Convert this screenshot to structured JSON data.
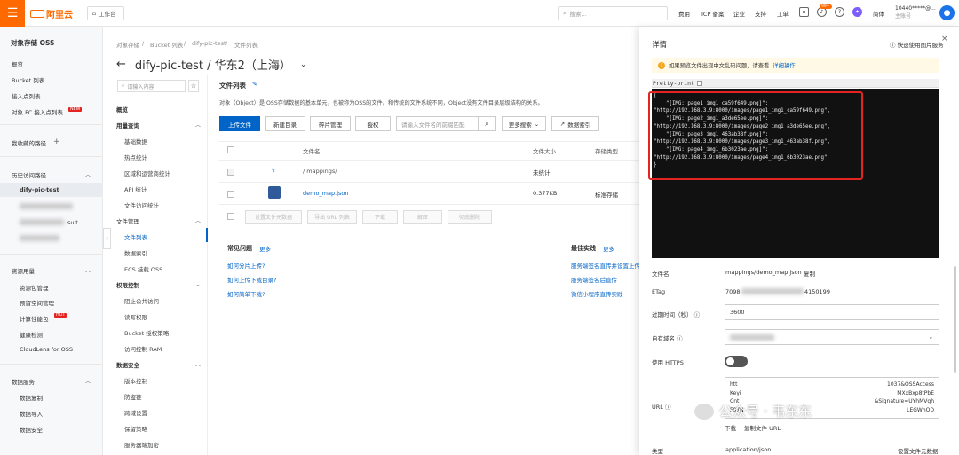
{
  "topbar": {
    "logo": "阿里云",
    "workspace": "工作台",
    "search_placeholder": "搜索...",
    "nav": [
      "费用",
      "ICP 备案",
      "企业",
      "支持",
      "工单"
    ],
    "badge": "99+",
    "lang": "简体",
    "user_id": "10440*****@...",
    "user_role": "主账号"
  },
  "sidebar": {
    "title": "对象存储 OSS",
    "items": [
      "概览",
      "Bucket 列表",
      "接入点列表",
      "对象 FC 接入点列表"
    ],
    "new_tag": "NEW",
    "favorites": "我收藏的路径",
    "history": "历史访问路径",
    "history_active": "dify-pic-test",
    "history_blur_suffix": "sult",
    "resource": "资源用量",
    "resource_items": [
      "资源包管理",
      "预留空间管理",
      "计算性能包",
      "健康检测",
      "CloudLens for OSS"
    ],
    "hot_tag": "HOT",
    "data_service": "数据服务",
    "data_items": [
      "数据复制",
      "数据导入",
      "数据安全"
    ]
  },
  "breadcrumb": [
    "对象存储",
    "Bucket 列表",
    "dify-pic-test",
    "文件列表"
  ],
  "page_title": "dify-pic-test / 华东2（上海）",
  "inner_nav": {
    "search_placeholder": "请输入内容",
    "overview": "概览",
    "groups": [
      {
        "title": "用量查询",
        "items": [
          "基础数据",
          "热点统计",
          "区域和运营商统计",
          "API 统计",
          "文件访问统计"
        ]
      },
      {
        "title": "文件管理",
        "items": [
          "文件列表",
          "数据索引",
          "ECS 挂载 OSS"
        ]
      },
      {
        "title": "权限控制",
        "items": [
          "阻止公共访问",
          "读写权限",
          "Bucket 授权策略",
          "访问控制 RAM"
        ]
      },
      {
        "title": "数据安全",
        "items": [
          "版本控制",
          "防盗链",
          "跨域设置",
          "保留策略",
          "服务器端加密"
        ]
      }
    ]
  },
  "main": {
    "title": "文件列表",
    "desc": "对象（Object）是 OSS存储数据的基本单元，也被称为OSS的文件。和传统的文件系统不同，Object没有文件目录层级结构的关系。",
    "buttons": [
      "上传文件",
      "新建目录",
      "碎片管理",
      "授权"
    ],
    "file_search_placeholder": "请输入文件名的前缀匹配",
    "more_search": "更多搜索",
    "data_index": "数据索引",
    "columns": [
      "文件名",
      "文件大小",
      "存储类型"
    ],
    "rows": [
      {
        "name": "/ mappings/",
        "size": "未统计",
        "type": ""
      },
      {
        "name": "demo_map.json",
        "size": "0.377KB",
        "type": "标准存储"
      }
    ],
    "bulk_buttons": [
      "设置文件元数据",
      "导出 URL 列表",
      "下载",
      "解压",
      "彻底删除"
    ]
  },
  "faq": {
    "title": "常见问题",
    "more": "更多",
    "items": [
      "如何分片上传?",
      "如何上传下载目录?",
      "如何简单下载?"
    ]
  },
  "best": {
    "title": "最佳实践",
    "more": "更多",
    "items": [
      "服务端签名直传并设置上传",
      "服务端签名后直传",
      "微信小程序直传实践"
    ]
  },
  "drawer": {
    "title": "详情",
    "help": "快速使用图片服务",
    "notice": "如果预览文件出现中文乱码问题，请查看",
    "notice_link": "详细操作",
    "pretty_print": "Pretty-print",
    "code": "{\n    \"[IMG::page1_img1_ca59f649.png]\":\n\"http://192.168.3.9:8000/images/page1_img1_ca59f649.png\",\n    \"[IMG::page2_img1_a3de65ee.png]\":\n\"http://192.168.3.9:8000/images/page2_img1_a3de65ee.png\",\n    \"[IMG::page3_img1_463ab38f.png]\":\n\"http://192.168.3.9:8000/images/page3_img1_463ab38f.png\",\n    \"[IMG::page4_img1_6b3023ae.png]\":\n\"http://192.168.3.9:8000/images/page4_img1_6b3023ae.png\"\n}",
    "filename_label": "文件名",
    "filename": "mappings/demo_map.json",
    "copy": "复制",
    "etag_label": "ETag",
    "etag_prefix": "7098",
    "etag_suffix": "4150199",
    "expire_label": "过期时间（秒）",
    "expire": "3600",
    "domain_label": "自有域名",
    "https_label": "使用 HTTPS",
    "url_label": "URL",
    "url_lines": [
      "htt",
      "Keyi",
      "Cnt",
      "F07N"
    ],
    "url_tail": [
      "1037&OSSAccess",
      "MXxBxp8tPbE",
      "&Signature=UYhMVgh",
      "LEGWhOD"
    ],
    "download": "下载",
    "copy_url": "复制文件 URL",
    "type_label": "类型",
    "type": "application/json",
    "meta_link": "设置文件元数据"
  },
  "watermark": "公众号 · 韦东东"
}
